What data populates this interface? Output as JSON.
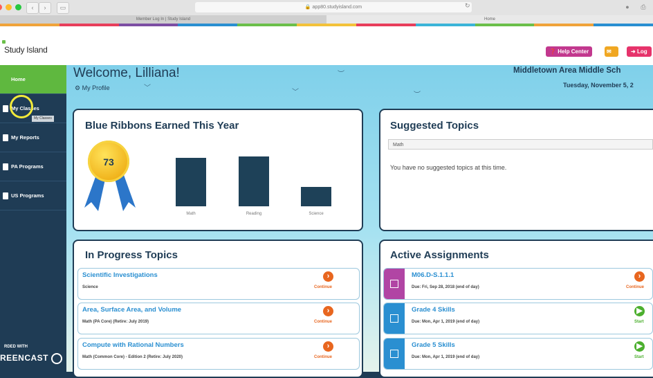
{
  "browser": {
    "url": "app80.studyisland.com",
    "tabs": [
      {
        "label": "Member Log In | Study Island"
      },
      {
        "label": "Home"
      }
    ],
    "traffic_colors": [
      "#ff5f57",
      "#febc2e",
      "#28c840"
    ],
    "rainbow_colors": [
      "#f0a33a",
      "#e83e5b",
      "#7c4ea3",
      "#2a8fd1",
      "#6bbf4a",
      "#f3c23a",
      "#e83e5b",
      "#3bb4d8",
      "#6bbf4a",
      "#f0a33a",
      "#2a8fd1"
    ]
  },
  "header": {
    "logo": "Study Island",
    "help_label": "Help Center",
    "log_label": "Log",
    "help_color": "#c2388e",
    "mid_color": "#f0a722",
    "log_color": "#e6336b"
  },
  "sidebar": {
    "items": [
      {
        "label": "Home",
        "icon": "home-icon"
      },
      {
        "label": "My Classes",
        "icon": "classes-icon"
      },
      {
        "label": "My Reports",
        "icon": "reports-icon"
      },
      {
        "label": "PA Programs",
        "icon": "pa-programs-icon"
      },
      {
        "label": "US Programs",
        "icon": "us-programs-icon"
      }
    ],
    "tooltip": "My Classes",
    "watermark_top": "RDED WITH",
    "watermark_bottom": "REENCAST"
  },
  "welcome": {
    "title": "Welcome, Lilliana!",
    "profile": "My Profile",
    "school": "Middletown Area Middle Sch",
    "date": "Tuesday, November 5, 2"
  },
  "ribbons": {
    "title": "Blue Ribbons Earned This Year",
    "total": "73",
    "chart_data": {
      "type": "bar",
      "categories": [
        "Math",
        "Reading",
        "Science"
      ],
      "values": [
        30,
        31,
        12
      ],
      "title": "Blue Ribbons Earned This Year"
    }
  },
  "suggested": {
    "title": "Suggested Topics",
    "selected": "Math",
    "empty_text": "You have no suggested topics at this time."
  },
  "in_progress": {
    "title": "In Progress Topics",
    "items": [
      {
        "title": "Scientific Investigations",
        "subtitle": "Science",
        "action": "Continue"
      },
      {
        "title": "Area, Surface Area, and Volume",
        "subtitle": "Math (PA Core) (Retire: July 2019)",
        "action": "Continue"
      },
      {
        "title": "Compute with Rational Numbers",
        "subtitle": "Math (Common Core) - Edition 2 (Retire: July 2020)",
        "action": "Continue"
      }
    ]
  },
  "assignments": {
    "title": "Active Assignments",
    "items": [
      {
        "title": "M06.D-S.1.1.1",
        "due": "Due: Fri, Sep 28, 2018 (end of day)",
        "action": "Continue",
        "color": "#b145a4"
      },
      {
        "title": "Grade 4 Skills",
        "due": "Due: Mon, Apr 1, 2019 (end of day)",
        "action": "Start",
        "color": "#2a8fd1"
      },
      {
        "title": "Grade 5 Skills",
        "due": "Due: Mon, Apr 1, 2019 (end of day)",
        "action": "Start",
        "color": "#2a8fd1"
      }
    ]
  }
}
